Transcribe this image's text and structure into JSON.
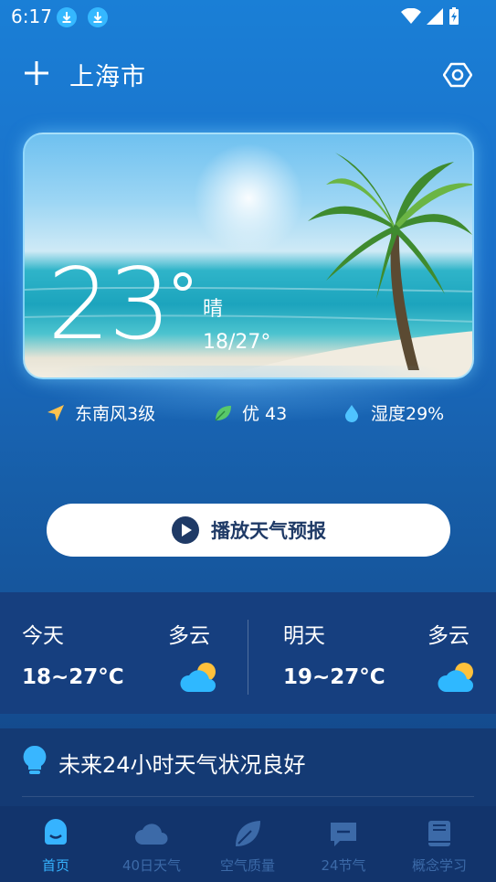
{
  "status_bar": {
    "time": "6:17"
  },
  "header": {
    "city": "上海市"
  },
  "current": {
    "temperature": "23",
    "condition": "晴",
    "range": "18/27°"
  },
  "stats": {
    "wind": "东南风3级",
    "air_quality": "优 43",
    "humidity": "湿度29%"
  },
  "play_button": {
    "label": "播放天气预报"
  },
  "forecast": [
    {
      "day": "今天",
      "condition": "多云",
      "temp": "18~27°C"
    },
    {
      "day": "明天",
      "condition": "多云",
      "temp": "19~27°C"
    }
  ],
  "tip": {
    "text": "未来24小时天气状况良好"
  },
  "nav": {
    "items": [
      {
        "label": "首页",
        "icon": "home-icon"
      },
      {
        "label": "40日天气",
        "icon": "cloud-icon"
      },
      {
        "label": "空气质量",
        "icon": "leaf-icon"
      },
      {
        "label": "24节气",
        "icon": "chat-icon"
      },
      {
        "label": "概念学习",
        "icon": "book-icon"
      }
    ],
    "active_index": 0
  },
  "colors": {
    "accent": "#36b3ff",
    "panel": "#163f7f",
    "nav": "#12346c"
  }
}
